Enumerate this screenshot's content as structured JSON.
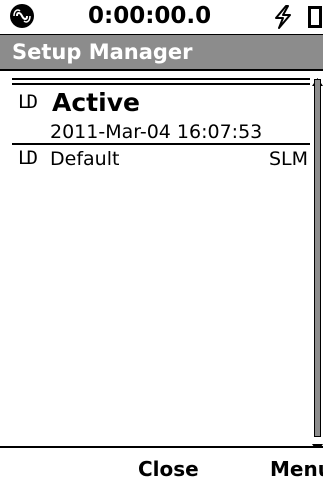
{
  "statusbar": {
    "timer": "0:00:00.0",
    "left_icon": "record-status-icon",
    "power_icon": "lightning-bolt-icon",
    "battery_icon": "battery-icon"
  },
  "title": "Setup Manager",
  "list": {
    "items": [
      {
        "icon_text": "LD",
        "name": "Active",
        "date": "2011-Mar-04 16:07:53",
        "selected": true
      },
      {
        "icon_text": "LD",
        "name": "Default",
        "type": "SLM",
        "selected": false
      }
    ]
  },
  "softkeys": {
    "left": "",
    "center": "Close",
    "right": "Menu"
  },
  "colors": {
    "title_bar": "#8c8c8c",
    "title_text": "#ffffff",
    "scroll_thumb": "#8c8c8c"
  }
}
